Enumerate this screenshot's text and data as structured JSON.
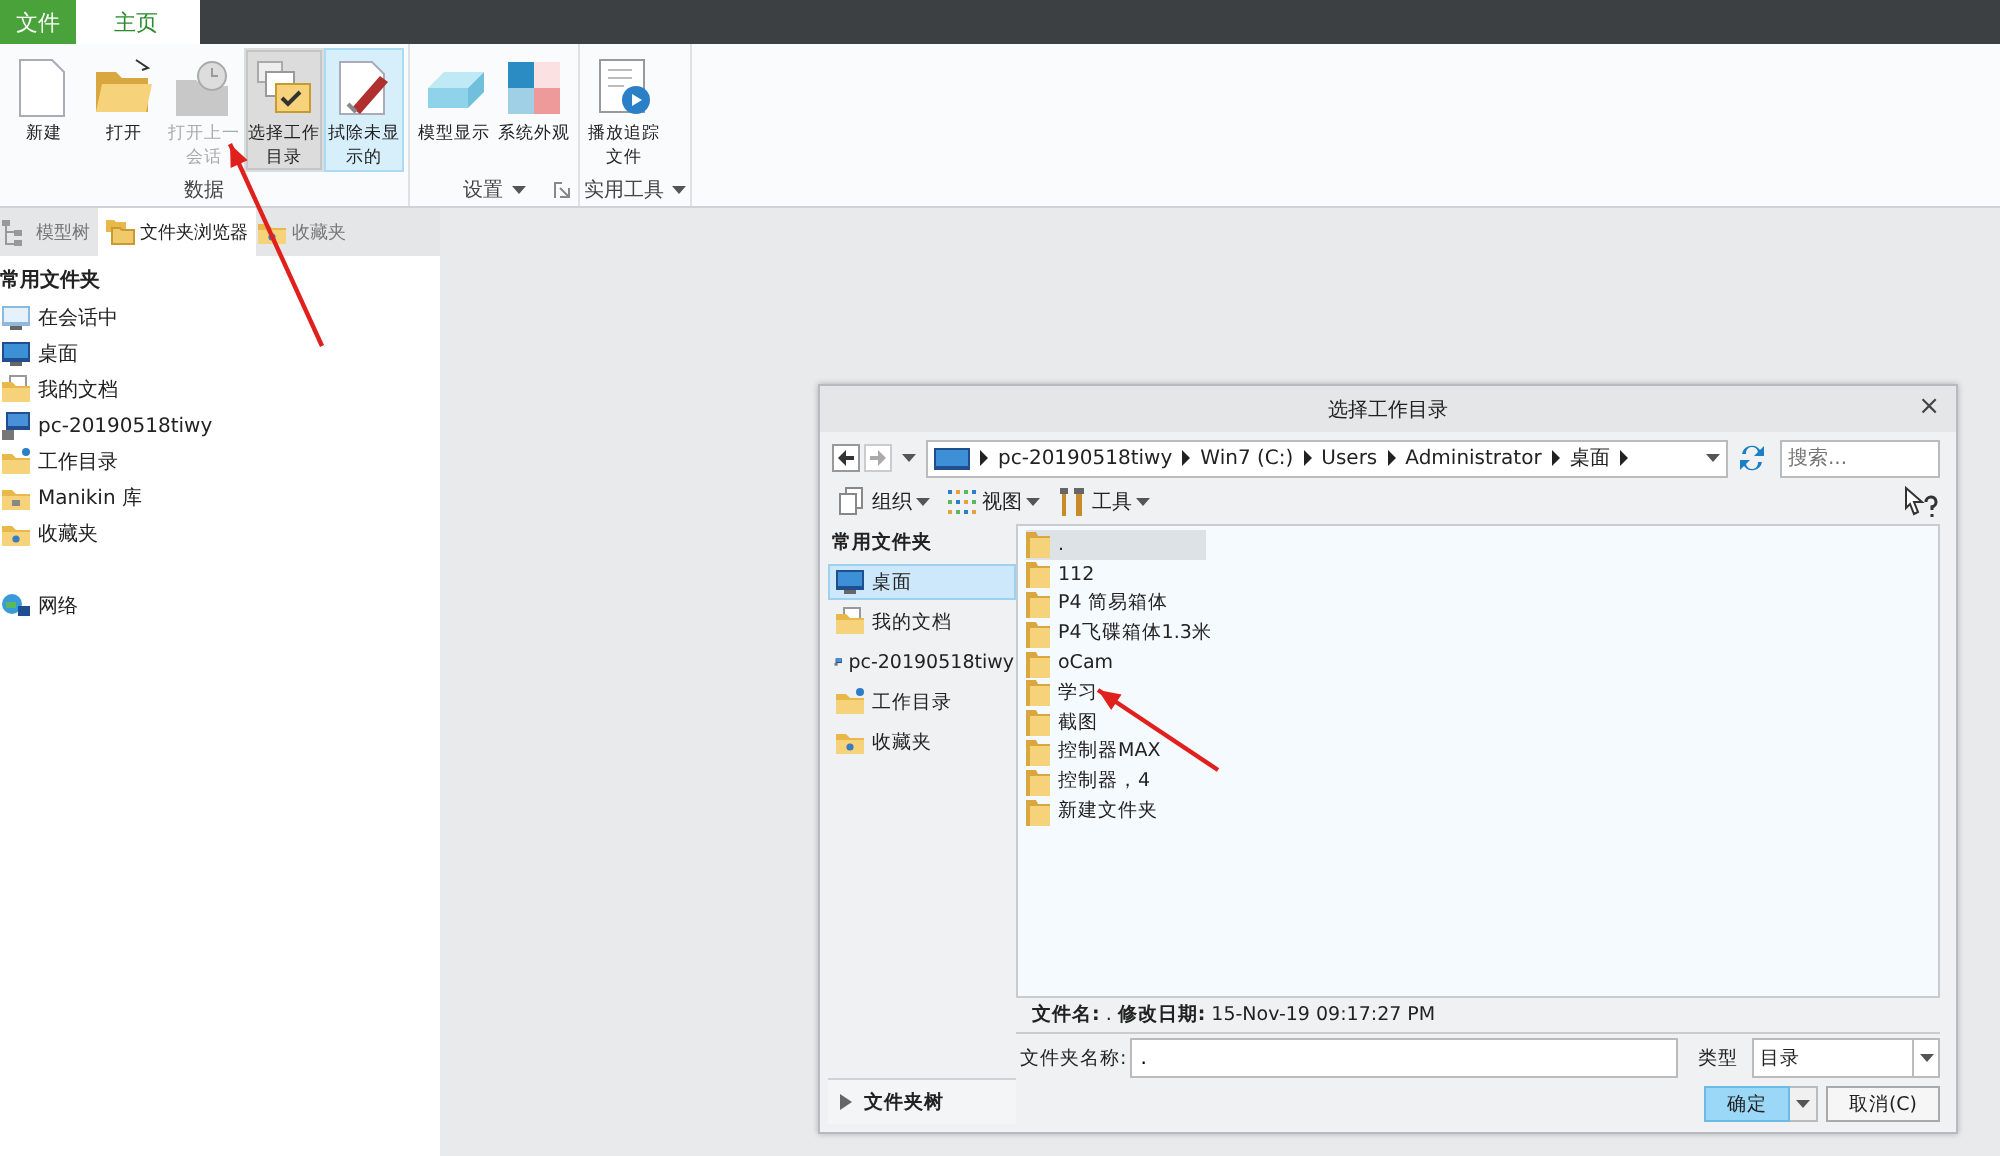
{
  "menu_tabs": [
    {
      "label": "文件",
      "kind": "file",
      "selected": false
    },
    {
      "label": "主页",
      "kind": "tab",
      "selected": true
    }
  ],
  "ribbon": {
    "groups": [
      {
        "label": "数据",
        "has_menu": false,
        "launcher": false,
        "buttons": [
          {
            "label": "新建",
            "disabled": false,
            "selected": false,
            "highlighted": false
          },
          {
            "label": "打开",
            "disabled": false,
            "selected": false,
            "highlighted": false
          },
          {
            "label": "打开上一会话",
            "disabled": true,
            "selected": false,
            "highlighted": false
          },
          {
            "label": "选择工作目录",
            "disabled": false,
            "selected": true,
            "highlighted": false
          },
          {
            "label": "拭除未显示的",
            "disabled": false,
            "selected": false,
            "highlighted": true
          }
        ]
      },
      {
        "label": "设置",
        "has_menu": true,
        "launcher": true,
        "buttons": [
          {
            "label": "模型显示",
            "disabled": false,
            "selected": false,
            "highlighted": false
          },
          {
            "label": "系统外观",
            "disabled": false,
            "selected": false,
            "highlighted": false
          }
        ]
      },
      {
        "label": "实用工具",
        "has_menu": true,
        "launcher": false,
        "buttons": [
          {
            "label": "播放追踪文件",
            "disabled": false,
            "selected": false,
            "highlighted": false
          }
        ]
      }
    ]
  },
  "navigator": {
    "tabs": [
      {
        "label": "模型树",
        "selected": false
      },
      {
        "label": "文件夹浏览器",
        "selected": true
      },
      {
        "label": "收藏夹",
        "selected": false
      }
    ],
    "section": "常用文件夹",
    "items": [
      {
        "label": "在会话中"
      },
      {
        "label": "桌面"
      },
      {
        "label": "我的文档"
      },
      {
        "label": "pc-20190518tiwy"
      },
      {
        "label": "工作目录"
      },
      {
        "label": "Manikin 库"
      },
      {
        "label": "收藏夹"
      }
    ],
    "network": {
      "label": "网络"
    }
  },
  "dialog": {
    "title": "选择工作目录",
    "close": "×",
    "breadcrumb": [
      "pc-20190518tiwy",
      "Win7 (C:)",
      "Users",
      "Administrator",
      "桌面"
    ],
    "search": {
      "placeholder": "搜索..."
    },
    "toolbar": [
      {
        "label": "组织"
      },
      {
        "label": "视图"
      },
      {
        "label": "工具"
      }
    ],
    "sidebar": {
      "section": "常用文件夹",
      "items": [
        {
          "label": "桌面",
          "selected": true
        },
        {
          "label": "我的文档",
          "selected": false
        },
        {
          "label": "pc-20190518tiwy",
          "selected": false
        },
        {
          "label": "工作目录",
          "selected": false
        },
        {
          "label": "收藏夹",
          "selected": false
        }
      ],
      "tree": "文件夹树"
    },
    "files": [
      {
        "name": ".",
        "selected": true
      },
      {
        "name": "112",
        "selected": false
      },
      {
        "name": "P4 简易箱体",
        "selected": false
      },
      {
        "name": "P4飞碟箱体1.3米",
        "selected": false
      },
      {
        "name": "oCam",
        "selected": false
      },
      {
        "name": "学习",
        "selected": false
      },
      {
        "name": "截图",
        "selected": false
      },
      {
        "name": "控制器MAX",
        "selected": false
      },
      {
        "name": "控制器，4",
        "selected": false
      },
      {
        "name": "新建文件夹",
        "selected": false
      }
    ],
    "details": "**文件名:** . **修改日期:** 15-Nov-19 09:17:27 PM",
    "folder_name": {
      "label": "文件夹名称:",
      "value": "."
    },
    "type": {
      "label": "类型",
      "value": "目录"
    },
    "buttons": [
      {
        "label": "确定",
        "kind": "primary"
      },
      {
        "label": "取消(C)",
        "kind": "normal"
      }
    ]
  }
}
